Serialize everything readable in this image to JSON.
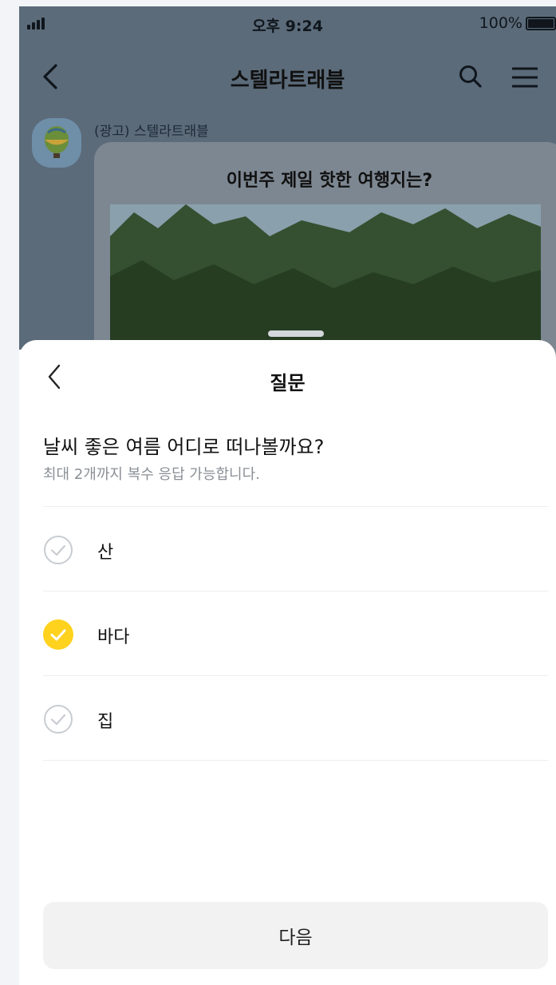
{
  "status_bar": {
    "time": "오후 9:24",
    "battery": "100%"
  },
  "header": {
    "title": "스텔라트래블"
  },
  "message": {
    "sender": "(광고) 스텔라트래블",
    "card_title": "이번주 제일 핫한 여행지는?"
  },
  "sheet": {
    "title": "질문",
    "question": "날씨 좋은 여름 어디로 떠나볼까요?",
    "hint": "최대 2개까지 복수 응답 가능합니다.",
    "options": [
      {
        "label": "산",
        "selected": false
      },
      {
        "label": "바다",
        "selected": true
      },
      {
        "label": "집",
        "selected": false
      }
    ],
    "next_label": "다음"
  },
  "colors": {
    "accent": "#ffd21e",
    "unchecked": "#c8ccd0",
    "overlay": "#5b6b7a"
  },
  "icons": [
    "signal-icon",
    "battery-icon",
    "back-icon",
    "search-icon",
    "menu-icon",
    "check-icon"
  ]
}
